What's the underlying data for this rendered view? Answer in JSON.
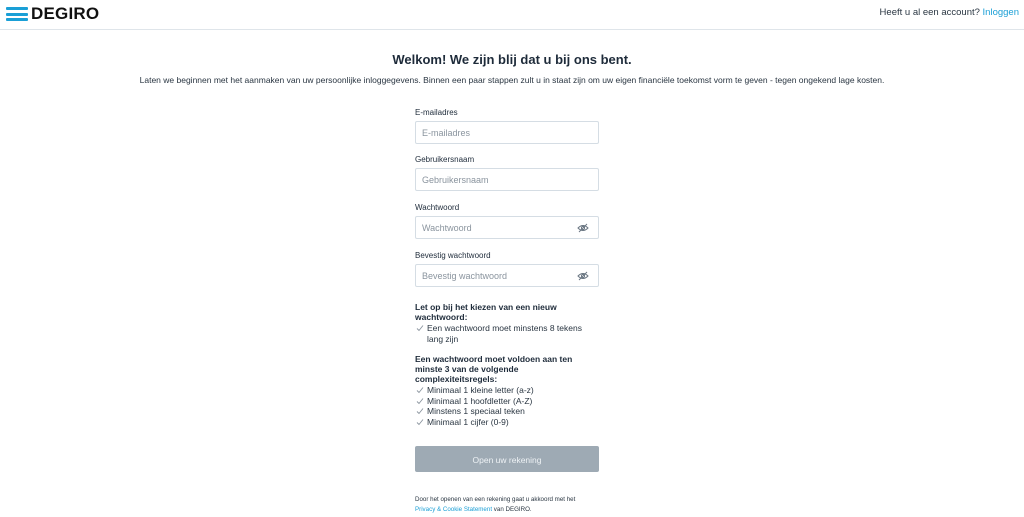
{
  "header": {
    "logo_text": "DEGIRO",
    "account_question": "Heeft u al een account?",
    "login_link": "Inloggen"
  },
  "main": {
    "title": "Welkom! We zijn blij dat u bij ons bent.",
    "subtitle": "Laten we beginnen met het aanmaken van uw persoonlijke inloggegevens. Binnen een paar stappen zult u in staat zijn om uw eigen financiële toekomst vorm te geven - tegen ongekend lage kosten."
  },
  "form": {
    "email": {
      "label": "E-mailadres",
      "placeholder": "E-mailadres",
      "value": ""
    },
    "username": {
      "label": "Gebruikersnaam",
      "placeholder": "Gebruikersnaam",
      "value": ""
    },
    "password": {
      "label": "Wachtwoord",
      "placeholder": "Wachtwoord",
      "value": ""
    },
    "confirm": {
      "label": "Bevestig wachtwoord",
      "placeholder": "Bevestig wachtwoord",
      "value": ""
    }
  },
  "rules": {
    "heading1": "Let op bij het kiezen van een nieuw wachtwoord:",
    "rule_length": "Een wachtwoord moet minstens 8 tekens lang zijn",
    "heading2": "Een wachtwoord moet voldoen aan ten minste 3 van de volgende complexiteitsregels:",
    "items": [
      "Minimaal 1 kleine letter (a-z)",
      "Minimaal 1 hoofdletter (A-Z)",
      "Minstens 1 speciaal teken",
      "Minimaal 1 cijfer (0-9)"
    ]
  },
  "submit_label": "Open uw rekening",
  "terms": {
    "prefix": "Door het openen van een rekening gaat u akkoord met het",
    "link": "Privacy & Cookie Statement",
    "suffix": "van DEGIRO."
  },
  "colors": {
    "accent": "#1a9fd6",
    "button_disabled": "#9eaab4",
    "text": "#1e2b3a"
  },
  "icons": {
    "password_toggle": "eye-slash-icon",
    "rule_status": "check-icon"
  }
}
